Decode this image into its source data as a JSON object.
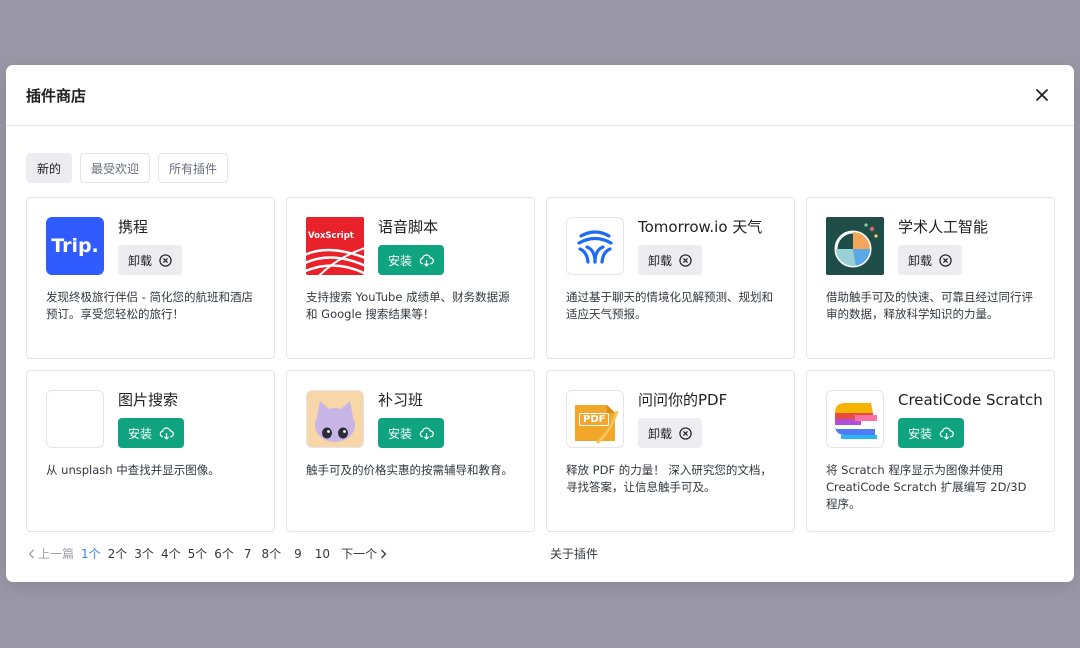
{
  "modal": {
    "title": "插件商店"
  },
  "tabs": [
    {
      "label": "新的"
    },
    {
      "label": "最受欢迎"
    },
    {
      "label": "所有插件"
    }
  ],
  "plugins": [
    {
      "name": "携程",
      "action": "卸载",
      "desc": "发现终极旅行伴侣 - 简化您的航班和酒店预订。享受您轻松的旅行！",
      "logo_text": "Trip."
    },
    {
      "name": "语音脚本",
      "action": "安装",
      "desc": "支持搜索 YouTube 成绩单、财务数据源和 Google 搜索结果等！",
      "logo_text": "VoxScript"
    },
    {
      "name": "Tomorrow.io 天气",
      "action": "卸载",
      "desc": "通过基于聊天的情境化见解预测、规划和适应天气预报。"
    },
    {
      "name": "学术人工智能",
      "action": "卸载",
      "desc": "借助触手可及的快速、可靠且经过同行评审的数据，释放科学知识的力量。"
    },
    {
      "name": "图片搜索",
      "action": "安装",
      "desc": "从 unsplash 中查找并显示图像。"
    },
    {
      "name": "补习班",
      "action": "安装",
      "desc": "触手可及的价格实惠的按需辅导和教育。"
    },
    {
      "name": "问问你的PDF",
      "action": "卸载",
      "desc": "释放 PDF 的力量！ 深入研究您的文档，寻找答案，让信息触手可及。",
      "logo_text": "PDF"
    },
    {
      "name": "CreatiCode Scratch",
      "action": "安装",
      "desc": "将 Scratch 程序显示为图像并使用 CreatiCode Scratch 扩展编写 2D/3D 程序。"
    }
  ],
  "pagination": {
    "prev": "上一篇",
    "pages": [
      "1个",
      "2个",
      "3个",
      "4个",
      "5个",
      "6个",
      "7",
      "8个",
      "9",
      "10"
    ],
    "next": "下一个"
  },
  "footer": {
    "about": "关于插件"
  },
  "colors": {
    "install": "#10a37f",
    "uninstall_bg": "#ececf1",
    "backdrop": "#9a98a7",
    "current_page": "#3b82f6"
  }
}
